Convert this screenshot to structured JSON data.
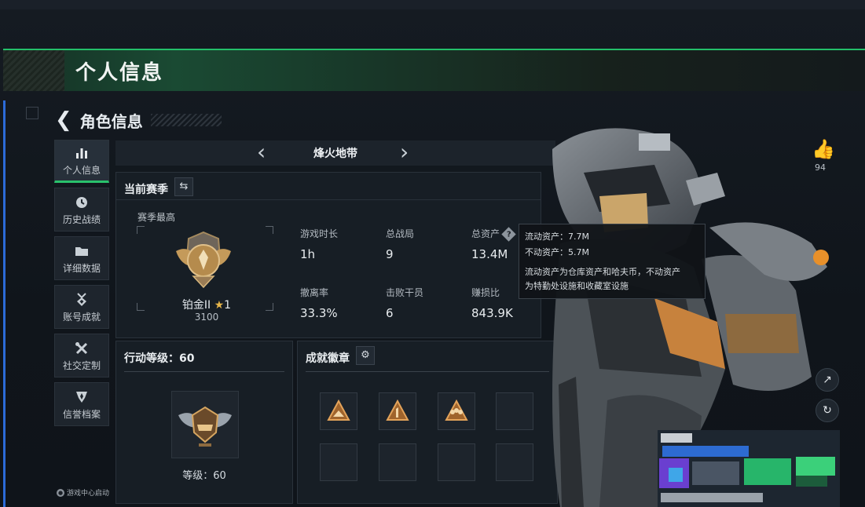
{
  "page": {
    "title": "个人信息"
  },
  "nav": {
    "back_label": "角色信息"
  },
  "sidebar": {
    "items": [
      {
        "label": "个人信息",
        "icon": "bar-chart-icon",
        "active": true
      },
      {
        "label": "历史战绩",
        "icon": "clock-icon",
        "active": false
      },
      {
        "label": "详细数据",
        "icon": "folder-icon",
        "active": false
      },
      {
        "label": "账号成就",
        "icon": "medal-icon",
        "active": false
      },
      {
        "label": "社交定制",
        "icon": "tools-icon",
        "active": false
      },
      {
        "label": "信誉档案",
        "icon": "shield-icon",
        "active": false
      }
    ],
    "launch_badge": "游戏中心启动"
  },
  "mode": {
    "name": "烽火地带",
    "prev_icon": "chevron-left-icon",
    "next_icon": "chevron-right-icon"
  },
  "season": {
    "title": "当前赛季",
    "peak_label": "赛季最高",
    "rank_name": "铂金II",
    "rank_stars": "1",
    "rank_score": "3100",
    "stats": [
      {
        "label": "游戏时长",
        "value": "1h"
      },
      {
        "label": "总战局",
        "value": "9"
      },
      {
        "label": "总资产",
        "value": "13.4M",
        "has_help": true
      },
      {
        "label": "撤离率",
        "value": "33.3%"
      },
      {
        "label": "击败干员",
        "value": "6"
      },
      {
        "label": "赚损比",
        "value": "843.9K"
      }
    ]
  },
  "tooltip": {
    "line1": "流动资产：7.7M",
    "line2": "不动资产：5.7M",
    "line3": "流动资产为仓库资产和哈夫币，不动资产",
    "line4": "为特勤处设施和收藏室设施"
  },
  "level": {
    "title": "行动等级：60",
    "caption": "等级：60"
  },
  "badges": {
    "title": "成就徽章"
  },
  "social": {
    "like_count": "94"
  },
  "colors": {
    "accent_green": "#24c06a",
    "accent_blue": "#2c6bd8",
    "rank_gold": "#c79a52",
    "star_gold": "#e7b64a"
  }
}
